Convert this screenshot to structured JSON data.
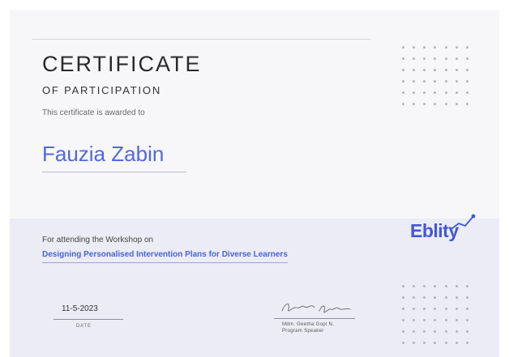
{
  "certificate": {
    "title": "CERTIFICATE",
    "subtitle": "OF PARTICIPATION",
    "awarded_text": "This certificate is awarded to",
    "recipient_name": "Fauzia Zabin",
    "attending_text": "For attending the Workshop on",
    "workshop_title": "Designing Personalised Intervention Plans for Diverse Learners"
  },
  "date": {
    "value": "11-5-2023",
    "label": "DATE"
  },
  "speaker": {
    "signature_text": "Geetha Gopi N",
    "name": "Mdm. Geetha Gopi N.",
    "role": "Program Speaker"
  },
  "logo": {
    "text": "Eblity",
    "icon": "rising-graph-icon"
  },
  "colors": {
    "accent": "#5168e0",
    "logo": "#4357d8",
    "background": "#f7f7f9",
    "band": "#ececf6",
    "dots": "#b3b3bd"
  }
}
